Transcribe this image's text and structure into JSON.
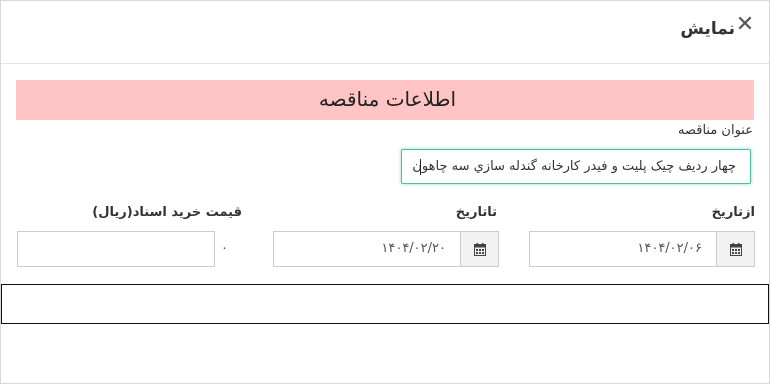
{
  "dialog": {
    "title": "نمایش",
    "close_symbol": "✕"
  },
  "banner": {
    "text": "اطلاعات مناقصه",
    "color": "#ffc4c3"
  },
  "subject": {
    "label": "عنوان مناقصه",
    "value": "چهار رديف چيک پليت و فيدر كارخانه گندله سازي سه چاهون",
    "border_color": "#4cbfa0"
  },
  "from_date": {
    "label": "ازتاریخ",
    "value": "۱۴۰۴/۰۲/۰۶",
    "icon": "calendar-icon"
  },
  "to_date": {
    "label": "تاتاریخ",
    "value": "۱۴۰۴/۰۲/۲۰",
    "icon": "calendar-icon"
  },
  "price": {
    "label": "قیمت خرید اسناد(ریال)",
    "value": "۰"
  }
}
